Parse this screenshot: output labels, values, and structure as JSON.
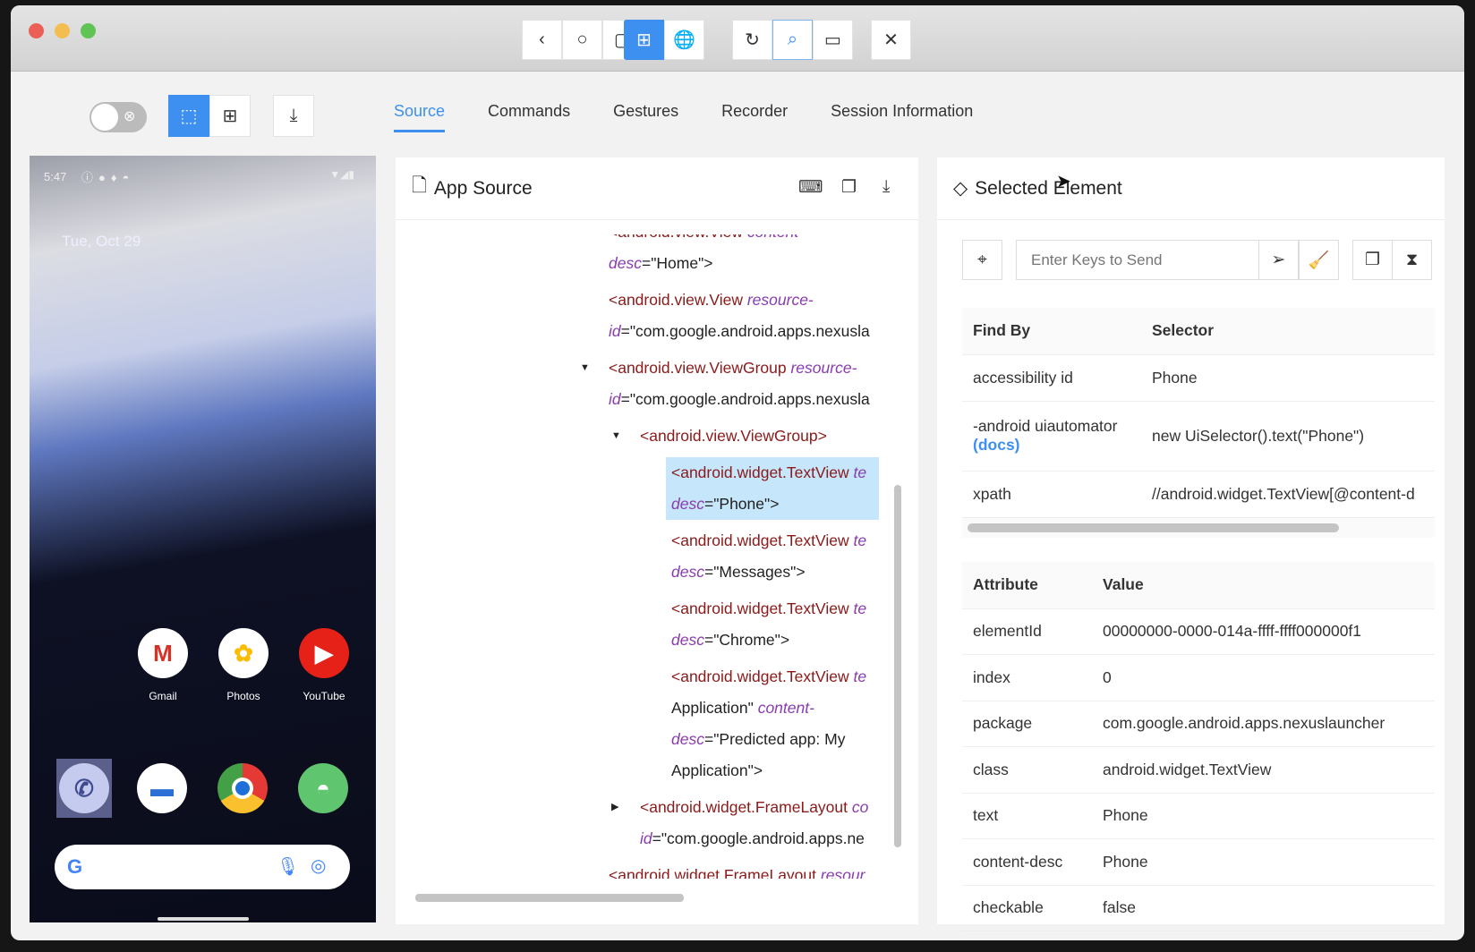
{
  "window": {
    "traffic_lights": [
      "#ec5f56",
      "#f4bd4f",
      "#5fc453"
    ],
    "toolbar": [
      {
        "name": "back-button",
        "icon": "‹"
      },
      {
        "name": "home-button",
        "icon": "○"
      },
      {
        "name": "app-switch-button",
        "icon": "▢"
      },
      {
        "name": "native-mode-button",
        "icon": "⊞",
        "active": true
      },
      {
        "name": "web-mode-button",
        "icon": "🌐"
      },
      {
        "name": "refresh-button",
        "icon": "↻"
      },
      {
        "name": "search-button",
        "icon": "⌕",
        "focused": true
      },
      {
        "name": "record-button",
        "icon": "▭"
      },
      {
        "name": "quit-session-button",
        "icon": "✕"
      }
    ]
  },
  "tabs": [
    "Source",
    "Commands",
    "Gestures",
    "Recorder",
    "Session Information"
  ],
  "active_tab": "Source",
  "device": {
    "time": "5:47",
    "date": "Tue, Oct 29",
    "apps": [
      "Gmail",
      "Photos",
      "YouTube"
    ],
    "search_logo": "G"
  },
  "source": {
    "title": "App Source",
    "nodes": [
      {
        "lines": [
          [
            [
              "tag",
              "<android.view.View "
            ],
            [
              "attr",
              "content-"
            ]
          ],
          [
            [
              "attr",
              "desc"
            ],
            [
              "pun",
              "=\"Home\">"
            ]
          ]
        ]
      },
      {
        "lines": [
          [
            [
              "tag",
              "<android.view.View "
            ],
            [
              "attr",
              "resource-"
            ]
          ],
          [
            [
              "attr",
              "id"
            ],
            [
              "pun",
              "=\"com.google.android.apps.nexusla"
            ]
          ]
        ]
      },
      {
        "arrow": "▼",
        "lines": [
          [
            [
              "tag",
              "<android.view.ViewGroup "
            ],
            [
              "attr",
              "resource-"
            ]
          ],
          [
            [
              "attr",
              "id"
            ],
            [
              "pun",
              "=\"com.google.android.apps.nexusla"
            ]
          ]
        ]
      },
      {
        "arrow": "▼",
        "lines": [
          [
            [
              "tag",
              "<android.view.ViewGroup>"
            ]
          ]
        ]
      },
      {
        "selected": true,
        "lines": [
          [
            [
              "tag",
              "<android.widget.TextView "
            ],
            [
              "attr",
              "te"
            ]
          ],
          [
            [
              "attr",
              "desc"
            ],
            [
              "pun",
              "=\"Phone\">"
            ]
          ]
        ]
      },
      {
        "lines": [
          [
            [
              "tag",
              "<android.widget.TextView "
            ],
            [
              "attr",
              "te"
            ]
          ],
          [
            [
              "attr",
              "desc"
            ],
            [
              "pun",
              "=\"Messages\">"
            ]
          ]
        ]
      },
      {
        "lines": [
          [
            [
              "tag",
              "<android.widget.TextView "
            ],
            [
              "attr",
              "te"
            ]
          ],
          [
            [
              "attr",
              "desc"
            ],
            [
              "pun",
              "=\"Chrome\">"
            ]
          ]
        ]
      },
      {
        "lines": [
          [
            [
              "tag",
              "<android.widget.TextView "
            ],
            [
              "attr",
              "te"
            ]
          ],
          [
            [
              "pun",
              "Application\" "
            ],
            [
              "attr",
              "content-"
            ]
          ],
          [
            [
              "attr",
              "desc"
            ],
            [
              "pun",
              "=\"Predicted app: My"
            ]
          ],
          [
            [
              "pun",
              "Application\">"
            ]
          ]
        ]
      },
      {
        "arrow": "▶",
        "lines": [
          [
            [
              "tag",
              "<android.widget.FrameLayout "
            ],
            [
              "attr",
              "co"
            ]
          ],
          [
            [
              "attr",
              "id"
            ],
            [
              "pun",
              "=\"com.google.android.apps.ne"
            ]
          ]
        ]
      },
      {
        "lines": [
          [
            [
              "tag",
              "<android.widget.FrameLayout "
            ],
            [
              "attr",
              "resour"
            ]
          ]
        ]
      }
    ]
  },
  "selected": {
    "title": "Selected Element",
    "send_keys_placeholder": "Enter Keys to Send",
    "selectors_header": [
      "Find By",
      "Selector"
    ],
    "selectors": [
      {
        "by": "accessibility id",
        "value": "Phone"
      },
      {
        "by": "-android uiautomator",
        "docs": "(docs)",
        "value": "new UiSelector().text(\"Phone\")"
      },
      {
        "by": "xpath",
        "value": "//android.widget.TextView[@content-d"
      }
    ],
    "attributes_header": [
      "Attribute",
      "Value"
    ],
    "attributes": [
      {
        "name": "elementId",
        "value": "00000000-0000-014a-ffff-ffff000000f1"
      },
      {
        "name": "index",
        "value": "0"
      },
      {
        "name": "package",
        "value": "com.google.android.apps.nexuslauncher"
      },
      {
        "name": "class",
        "value": "android.widget.TextView"
      },
      {
        "name": "text",
        "value": "Phone"
      },
      {
        "name": "content-desc",
        "value": "Phone"
      },
      {
        "name": "checkable",
        "value": "false"
      }
    ]
  },
  "accent": "#3d8ff0"
}
